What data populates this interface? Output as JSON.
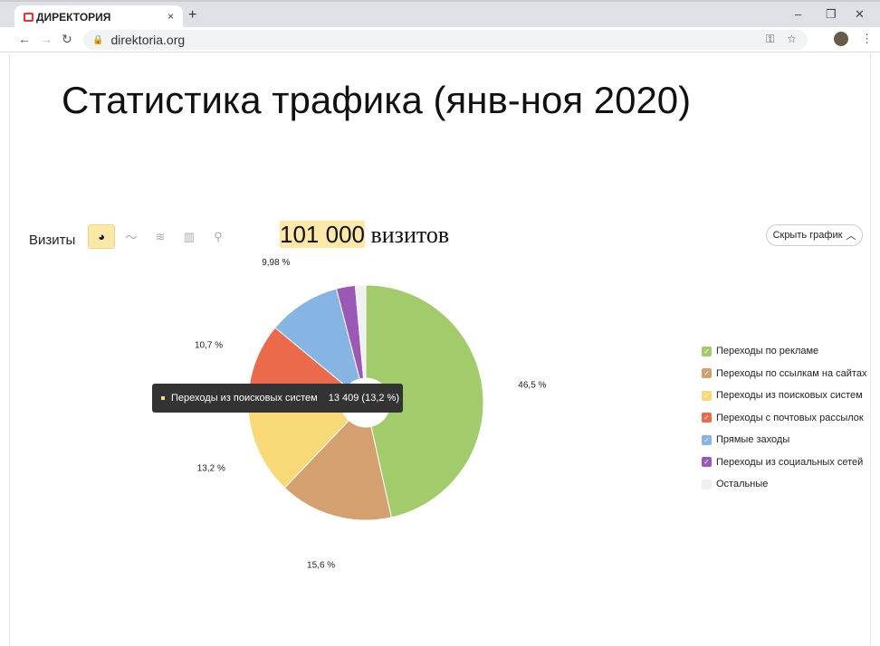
{
  "browser": {
    "tab_title": "ДИРЕКТОРИЯ",
    "url": "direktoria.org",
    "close": "×",
    "new_tab": "+",
    "minimize": "–",
    "restore": "❐",
    "close_window": "✕"
  },
  "page": {
    "title": "Статистика трафика (янв-ноя 2020)"
  },
  "report": {
    "metric_label": "Визиты",
    "total_number": "101 000",
    "total_unit": " визитов",
    "hide_chart": "Скрыть график"
  },
  "tooltip": {
    "label": "Переходы из поисковых систем",
    "value": "13 409 (13,2 %)"
  },
  "chart_data": {
    "type": "pie",
    "donut": true,
    "categories": [
      "Переходы по рекламе",
      "Переходы по ссылкам на сайтах",
      "Переходы из поисковых систем",
      "Переходы с почтовых рассылок",
      "Прямые заходы",
      "Переходы из социальных сетей",
      "Остальные"
    ],
    "values": [
      46.5,
      15.6,
      13.2,
      10.7,
      9.98,
      2.6,
      1.42
    ],
    "labels": [
      "46,5 %",
      "15,6 %",
      "13,2 %",
      "10,7 %",
      "9,98 %",
      "",
      ""
    ],
    "colors": [
      "#a2cb6b",
      "#d4a070",
      "#f9d877",
      "#ea6a4b",
      "#86b4e3",
      "#9b59b6",
      "#f0f0f0"
    ],
    "legend_position": "right"
  }
}
